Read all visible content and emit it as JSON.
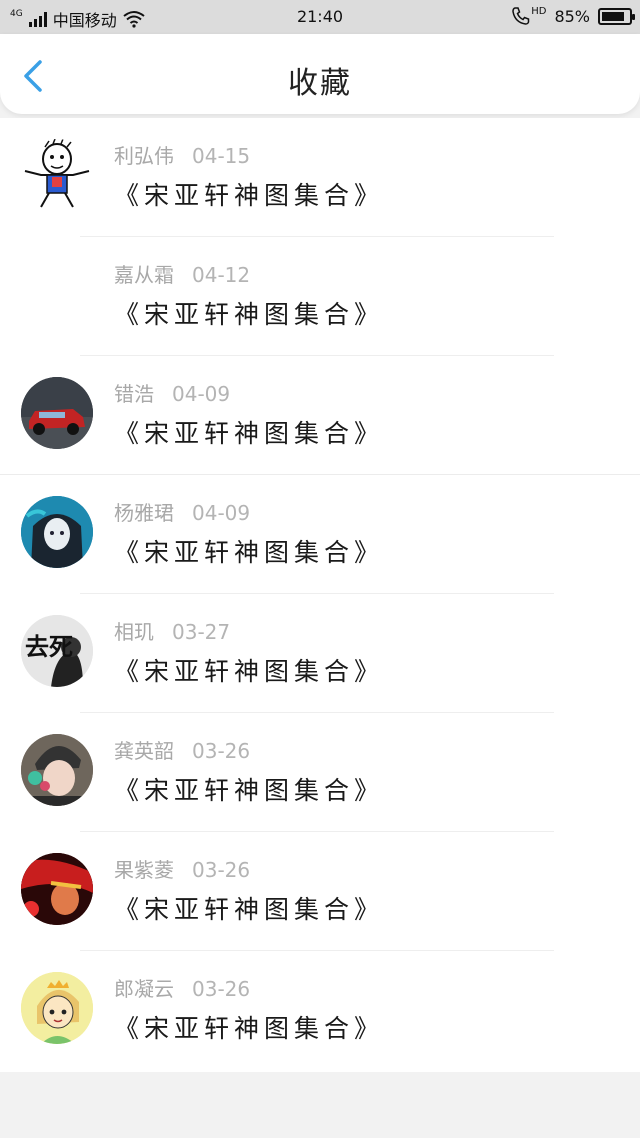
{
  "statusbar": {
    "network": "4G",
    "carrier": "中国移动",
    "time": "21:40",
    "call_icon": "phone-hd-icon",
    "hd": "HD",
    "battery": "85%"
  },
  "navbar": {
    "back_icon": "chevron-left-icon",
    "title": "收藏"
  },
  "items": [
    {
      "name": "利弘伟",
      "date": "04-15",
      "title": "《宋亚轩神图集合》",
      "avatar": "cartoon-man-avatar"
    },
    {
      "name": "嘉从霜",
      "date": "04-12",
      "title": "《宋亚轩神图集合》",
      "avatar": "none"
    },
    {
      "name": "错浩",
      "date": "04-09",
      "title": "《宋亚轩神图集合》",
      "avatar": "red-car-avatar"
    },
    {
      "name": "杨雅珺",
      "date": "04-09",
      "title": "《宋亚轩神图集合》",
      "avatar": "anime-girl-avatar"
    },
    {
      "name": "相玑",
      "date": "03-27",
      "title": "《宋亚轩神图集合》",
      "avatar": "qusi-text-avatar",
      "avatar_text": "去死"
    },
    {
      "name": "龚英韶",
      "date": "03-26",
      "title": "《宋亚轩神图集合》",
      "avatar": "girl-photo-avatar"
    },
    {
      "name": "果紫菱",
      "date": "03-26",
      "title": "《宋亚轩神图集合》",
      "avatar": "red-anime-avatar"
    },
    {
      "name": "郎凝云",
      "date": "03-26",
      "title": "《宋亚轩神图集合》",
      "avatar": "cartoon-girl-avatar"
    }
  ],
  "colors": {
    "accent": "#3aa0e6",
    "statusbar_bg": "#dcdcdc",
    "page_bg": "#f2f2f2"
  }
}
